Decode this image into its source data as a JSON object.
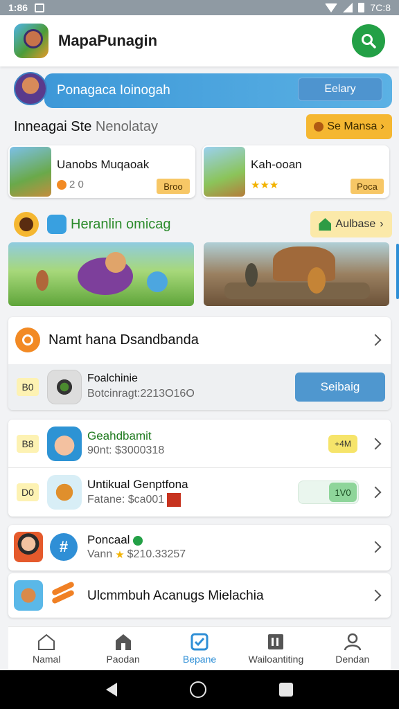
{
  "status_bar": {
    "time": "1:86",
    "right_text": "7C:8"
  },
  "app_bar": {
    "title": "MapaPunagin"
  },
  "banner": {
    "text": "Ponagaca Ioinogah",
    "button": "Eelary"
  },
  "section": {
    "title_main": "Inneagai Ste",
    "title_muted": "Nenolatay",
    "more_button": "Se Mansa"
  },
  "games": [
    {
      "name": "Uanobs Muqaoak",
      "meta": "2 0",
      "button": "Broo",
      "thumb_color": "#6aa94a"
    },
    {
      "name": "Kah-ooan",
      "meta_stars": "★★★",
      "button": "Poca",
      "thumb_color": "#8bc45a"
    }
  ],
  "featured": {
    "title": "Heranlin omicag",
    "button": "Aulbase"
  },
  "list_a": {
    "header": "Namt hana Dsandbanda",
    "item": {
      "tag": "B0",
      "title": "Foalchinie",
      "subtitle": "Botcinragt:2213O16O",
      "button": "Seibaig"
    }
  },
  "list_b": [
    {
      "tag": "B8",
      "title": "Geahdbamit",
      "subtitle": "90nt: $3000318",
      "badge": "+4M"
    },
    {
      "tag": "D0",
      "title": "Untikual Genptfona",
      "subtitle": "Fatane: $ca001",
      "badge": "1V0"
    }
  ],
  "list_c": [
    {
      "title": "Poncaal",
      "subtitle_prefix": "Vann",
      "subtitle_value": "$210.33257"
    },
    {
      "title": "Ulcmmbuh Acanugs Mielachia"
    }
  ],
  "bottom_nav": [
    {
      "label": "Namal",
      "icon": "home-outline-icon"
    },
    {
      "label": "Paodan",
      "icon": "store-icon"
    },
    {
      "label": "Bepane",
      "icon": "checkbox-icon"
    },
    {
      "label": "Wailoantiting",
      "icon": "book-icon"
    },
    {
      "label": "Dendan",
      "icon": "profile-icon"
    }
  ],
  "colors": {
    "accent_green": "#23a046",
    "accent_blue": "#2f8fd6",
    "accent_yellow": "#f5b731"
  }
}
